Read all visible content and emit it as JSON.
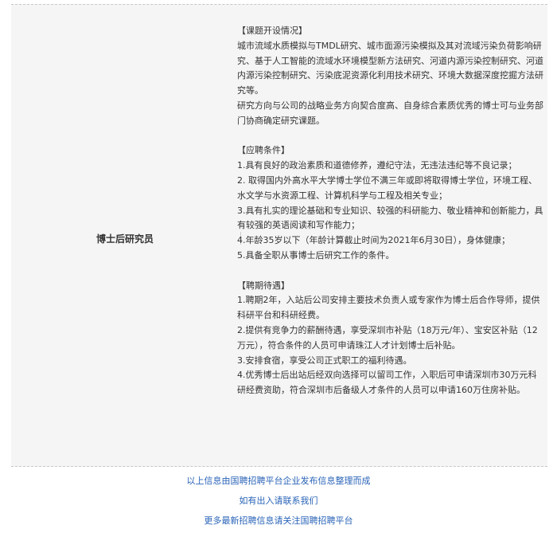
{
  "position": {
    "title": "博士后研究员"
  },
  "sections": [
    {
      "heading": "【课题开设情况】",
      "lines": [
        "城市流域水质模拟与TMDL研究、城市面源污染模拟及其对流域污染负荷影响研究、基于人工智能的流域水环境模型新方法研究、河道内源污染控制研究、河道内源污染控制研究、污染底泥资源化利用技术研究、环境大数据深度挖掘方法研究等。",
        "研究方向与公司的战略业务方向契合度高、自身综合素质优秀的博士可与业务部门协商确定研究课题。"
      ]
    },
    {
      "heading": "【应聘条件】",
      "lines": [
        "1.具有良好的政治素质和道德修养，遵纪守法，无违法违纪等不良记录；",
        "2. 取得国内外高水平大学博士学位不满三年或即将取得博士学位，环境工程、水文学与水资源工程、计算机科学与工程及相关专业；",
        "3.具有扎实的理论基础和专业知识、较强的科研能力、敬业精神和创新能力，具有较强的英语阅读和写作能力；",
        "4.年龄35岁以下（年龄计算截止时间为2021年6月30日），身体健康；",
        "5.具备全职从事博士后研究工作的条件。"
      ]
    },
    {
      "heading": "【聘期待遇】",
      "lines": [
        "1.聘期2年，入站后公司安排主要技术负责人或专家作为博士后合作导师，提供科研平台和科研经费。",
        "2.提供有竞争力的薪酬待遇，享受深圳市补贴（18万元/年）、宝安区补贴（12万元），符合条件的人员可申请珠江人才计划博士后补贴。",
        "3.安排食宿，享受公司正式职工的福利待遇。",
        "4.优秀博士后出站后经双向选择可以留司工作，入职后可申请深圳市30万元科研经费资助，符合深圳市后备级人才条件的人员可以申请160万住房补贴。"
      ]
    }
  ],
  "footer": {
    "line1": "以上信息由国聘招聘平台企业发布信息整理而成",
    "line2": "如有出入请联系我们",
    "line3": "更多最新招聘信息请关注国聘招聘平台"
  },
  "colors": {
    "card_background": "#f5f5f5",
    "footer_link": "#2a64b8",
    "text": "#333333"
  }
}
